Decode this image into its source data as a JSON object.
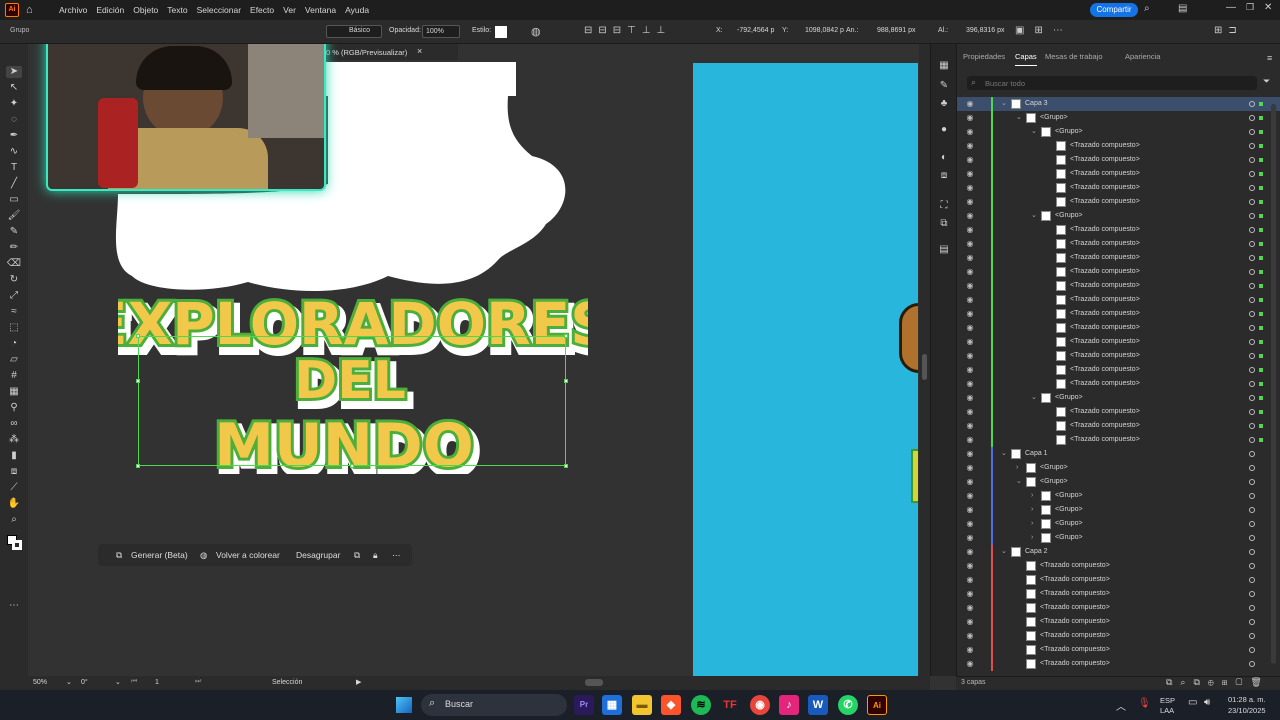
{
  "menu": {
    "items": [
      "Archivo",
      "Edición",
      "Objeto",
      "Texto",
      "Seleccionar",
      "Efecto",
      "Ver",
      "Ventana",
      "Ayuda"
    ],
    "share": "Compartir"
  },
  "control": {
    "selection": "Grupo",
    "stroke_style": "Básico",
    "opacity_label": "Opacidad:",
    "opacity_value": "100%",
    "style_label": "Estilo:",
    "x_label": "X:",
    "x_value": "-792,4564 p",
    "y_label": "Y:",
    "y_value": "1098,0842 p",
    "w_label": "An.:",
    "w_value": "988,8691 px",
    "h_label": "Al.:",
    "h_value": "396,8316 px"
  },
  "doc_tab": {
    "label": "0 % (RGB/Previsualizar)",
    "close": "×"
  },
  "canvas": {
    "title_lines": [
      "EXPLORADORES",
      "DEL",
      "MUNDO"
    ]
  },
  "context_bar": {
    "generate": "Generar (Beta)",
    "recolor": "Volver a colorear",
    "ungroup": "Desagrupar"
  },
  "panel": {
    "tabs": [
      "Propiedades",
      "Capas",
      "Mesas de trabajo",
      "Apariencia"
    ],
    "search_placeholder": "Buscar todo",
    "footer": "3 capas"
  },
  "layers": [
    {
      "label": "Capa 3",
      "indent": 0,
      "sel": true,
      "bar": "#4dd84d",
      "sq": "#4dd84d",
      "exp": "v",
      "thumb": true
    },
    {
      "label": "<Grupo>",
      "indent": 1,
      "bar": "#4dd84d",
      "sq": "#4dd84d",
      "exp": "v",
      "thumb": true
    },
    {
      "label": "<Grupo>",
      "indent": 2,
      "bar": "#4dd84d",
      "sq": "#4dd84d",
      "exp": "v",
      "thumb": true
    },
    {
      "label": "<Trazado compuesto>",
      "indent": 3,
      "bar": "#4dd84d",
      "sq": "#4dd84d",
      "thumb": true
    },
    {
      "label": "<Trazado compuesto>",
      "indent": 3,
      "bar": "#4dd84d",
      "sq": "#4dd84d",
      "thumb": true
    },
    {
      "label": "<Trazado compuesto>",
      "indent": 3,
      "bar": "#4dd84d",
      "sq": "#4dd84d",
      "thumb": true
    },
    {
      "label": "<Trazado compuesto>",
      "indent": 3,
      "bar": "#4dd84d",
      "sq": "#4dd84d",
      "thumb": true
    },
    {
      "label": "<Trazado compuesto>",
      "indent": 3,
      "bar": "#4dd84d",
      "sq": "#4dd84d",
      "thumb": true
    },
    {
      "label": "<Grupo>",
      "indent": 2,
      "bar": "#4dd84d",
      "sq": "#4dd84d",
      "exp": "v",
      "thumb": true
    },
    {
      "label": "<Trazado compuesto>",
      "indent": 3,
      "bar": "#4dd84d",
      "sq": "#4dd84d",
      "thumb": true
    },
    {
      "label": "<Trazado compuesto>",
      "indent": 3,
      "bar": "#4dd84d",
      "sq": "#4dd84d",
      "thumb": true
    },
    {
      "label": "<Trazado compuesto>",
      "indent": 3,
      "bar": "#4dd84d",
      "sq": "#4dd84d",
      "thumb": true
    },
    {
      "label": "<Trazado compuesto>",
      "indent": 3,
      "bar": "#4dd84d",
      "sq": "#4dd84d",
      "thumb": true
    },
    {
      "label": "<Trazado compuesto>",
      "indent": 3,
      "bar": "#4dd84d",
      "sq": "#4dd84d",
      "thumb": true
    },
    {
      "label": "<Trazado compuesto>",
      "indent": 3,
      "bar": "#4dd84d",
      "sq": "#4dd84d",
      "thumb": true
    },
    {
      "label": "<Trazado compuesto>",
      "indent": 3,
      "bar": "#4dd84d",
      "sq": "#4dd84d",
      "thumb": true
    },
    {
      "label": "<Trazado compuesto>",
      "indent": 3,
      "bar": "#4dd84d",
      "sq": "#4dd84d",
      "thumb": true
    },
    {
      "label": "<Trazado compuesto>",
      "indent": 3,
      "bar": "#4dd84d",
      "sq": "#4dd84d",
      "thumb": true
    },
    {
      "label": "<Trazado compuesto>",
      "indent": 3,
      "bar": "#4dd84d",
      "sq": "#4dd84d",
      "thumb": true
    },
    {
      "label": "<Trazado compuesto>",
      "indent": 3,
      "bar": "#4dd84d",
      "sq": "#4dd84d",
      "thumb": true
    },
    {
      "label": "<Trazado compuesto>",
      "indent": 3,
      "bar": "#4dd84d",
      "sq": "#4dd84d",
      "thumb": true
    },
    {
      "label": "<Grupo>",
      "indent": 2,
      "bar": "#4dd84d",
      "sq": "#4dd84d",
      "exp": "v",
      "thumb": true
    },
    {
      "label": "<Trazado compuesto>",
      "indent": 3,
      "bar": "#4dd84d",
      "sq": "#4dd84d",
      "thumb": true
    },
    {
      "label": "<Trazado compuesto>",
      "indent": 3,
      "bar": "#4dd84d",
      "sq": "#4dd84d",
      "thumb": true
    },
    {
      "label": "<Trazado compuesto>",
      "indent": 3,
      "bar": "#4dd84d",
      "sq": "#4dd84d",
      "thumb": true
    },
    {
      "label": "Capa 1",
      "indent": 0,
      "bar": "#4f6fe0",
      "exp": "v",
      "thumb": true
    },
    {
      "label": "<Grupo>",
      "indent": 1,
      "bar": "#4f6fe0",
      "exp": ">",
      "thumb": true
    },
    {
      "label": "<Grupo>",
      "indent": 1,
      "bar": "#4f6fe0",
      "exp": "v",
      "thumb": true
    },
    {
      "label": "<Grupo>",
      "indent": 2,
      "bar": "#4f6fe0",
      "exp": ">",
      "thumb": true
    },
    {
      "label": "<Grupo>",
      "indent": 2,
      "bar": "#4f6fe0",
      "exp": ">",
      "thumb": true
    },
    {
      "label": "<Grupo>",
      "indent": 2,
      "bar": "#4f6fe0",
      "exp": ">",
      "thumb": true
    },
    {
      "label": "<Grupo>",
      "indent": 2,
      "bar": "#4f6fe0",
      "exp": ">",
      "thumb": true
    },
    {
      "label": "Capa 2",
      "indent": 0,
      "bar": "#e04f4f",
      "exp": "v",
      "thumb": true
    },
    {
      "label": "<Trazado compuesto>",
      "indent": 1,
      "bar": "#e04f4f",
      "thumb": true
    },
    {
      "label": "<Trazado compuesto>",
      "indent": 1,
      "bar": "#e04f4f",
      "thumb": true
    },
    {
      "label": "<Trazado compuesto>",
      "indent": 1,
      "bar": "#e04f4f",
      "thumb": true
    },
    {
      "label": "<Trazado compuesto>",
      "indent": 1,
      "bar": "#e04f4f",
      "thumb": true
    },
    {
      "label": "<Trazado compuesto>",
      "indent": 1,
      "bar": "#e04f4f",
      "thumb": true
    },
    {
      "label": "<Trazado compuesto>",
      "indent": 1,
      "bar": "#e04f4f",
      "thumb": true
    },
    {
      "label": "<Trazado compuesto>",
      "indent": 1,
      "bar": "#e04f4f",
      "thumb": true
    },
    {
      "label": "<Trazado compuesto>",
      "indent": 1,
      "bar": "#e04f4f",
      "thumb": true
    }
  ],
  "status": {
    "zoom": "50%",
    "rotation": "0°",
    "artboard": "1",
    "tool": "Selección"
  },
  "taskbar": {
    "search": "Buscar",
    "lang1": "ESP",
    "lang2": "LAA",
    "time": "01:28 a. m.",
    "date": "23/10/2025"
  },
  "colors": {
    "accent": "#1473e6",
    "artboard_cyan": "#29b6dc",
    "selection": "#4dd84d"
  }
}
